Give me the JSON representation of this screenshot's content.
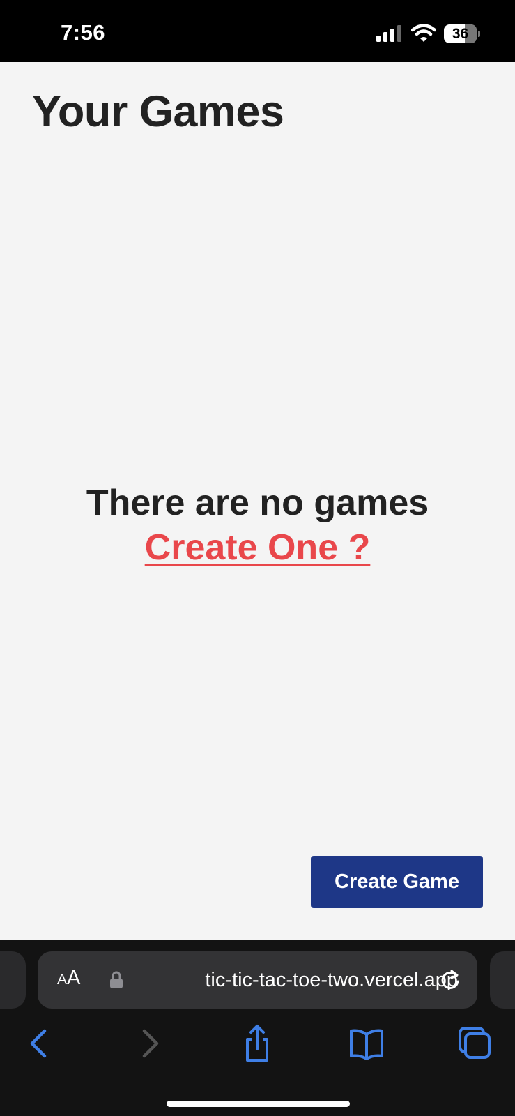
{
  "status_bar": {
    "time": "7:56",
    "battery_level": "36",
    "icons": [
      "signal-icon",
      "wifi-icon",
      "battery-icon"
    ]
  },
  "page": {
    "title": "Your Games",
    "empty_message": "There are no games",
    "create_link": "Create One ?",
    "create_button": "Create Game"
  },
  "browser": {
    "text_size_button_small": "A",
    "text_size_button_large": "A",
    "url": "tic-tic-tac-toe-two.vercel.app",
    "icons": [
      "lock-icon",
      "reload-icon",
      "back-icon",
      "forward-icon",
      "share-icon",
      "bookmarks-icon",
      "tabs-icon"
    ]
  },
  "colors": {
    "background": "#f4f4f4",
    "title_text": "#222222",
    "link_accent": "#e9474b",
    "button_primary": "#1e3787",
    "browser_chrome": "#131313",
    "toolbar_icon": "#3f7fe6"
  }
}
